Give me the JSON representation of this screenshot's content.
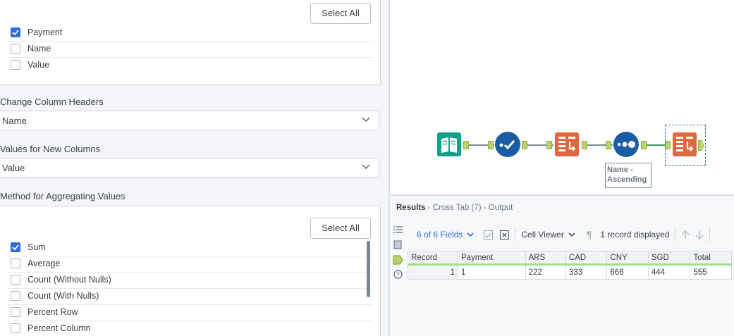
{
  "left": {
    "top_select_all": "Select All",
    "group_fields": [
      {
        "label": "Payment",
        "checked": true
      },
      {
        "label": "Name",
        "checked": false
      },
      {
        "label": "Value",
        "checked": false
      }
    ],
    "headers_label": "Change Column Headers",
    "headers_value": "Name",
    "values_label": "Values for New Columns",
    "values_value": "Value",
    "method_label": "Method for Aggregating Values",
    "method_select_all": "Select All",
    "methods": [
      {
        "label": "Sum",
        "checked": true
      },
      {
        "label": "Average",
        "checked": false
      },
      {
        "label": "Count (Without Nulls)",
        "checked": false
      },
      {
        "label": "Count (With Nulls)",
        "checked": false
      },
      {
        "label": "Percent Row",
        "checked": false
      },
      {
        "label": "Percent Column",
        "checked": false
      }
    ]
  },
  "canvas": {
    "tools": [
      "input-data-tool",
      "select-records-tool",
      "cross-tab-tool",
      "sort-tool",
      "cross-tab-tool"
    ],
    "note": [
      "Name -",
      "Ascending"
    ],
    "colors": {
      "input": "#0f9f8a",
      "blue": "#1a5da5",
      "orange": "#e2673f",
      "connector": "#7f8a95",
      "anchor": "#b7d46a"
    }
  },
  "results": {
    "title": "Results",
    "subtitle": "- Cross Tab (7) - Output",
    "fields": "6 of 6 Fields",
    "viewer": "Cell Viewer",
    "record_count": "1 record displayed",
    "columns": [
      "Record",
      "Payment",
      "ARS",
      "CAD",
      "CNY",
      "SGD",
      "Total"
    ],
    "rows": [
      [
        "1",
        "1",
        "222",
        "333",
        "666",
        "444",
        "555"
      ]
    ]
  }
}
